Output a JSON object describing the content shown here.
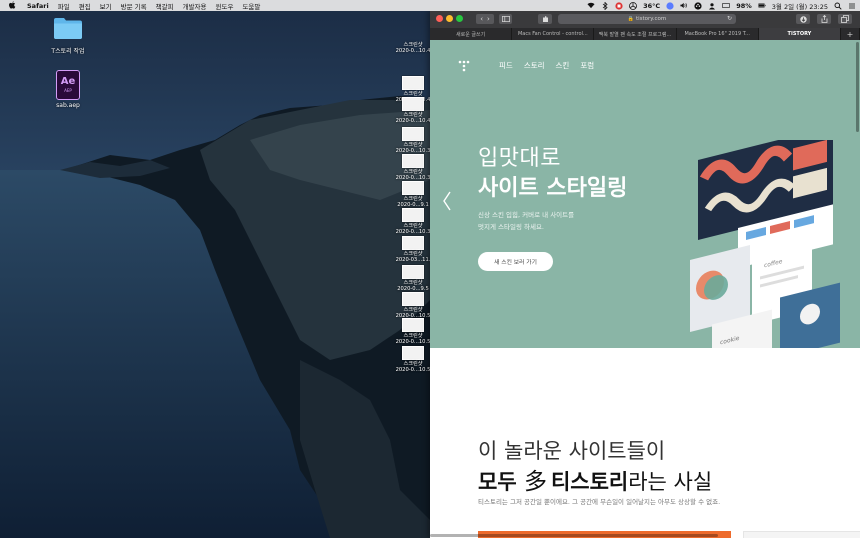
{
  "menubar": {
    "app_name": "Safari",
    "menus": [
      "파일",
      "편집",
      "보기",
      "방문 기록",
      "책갈피",
      "개발자용",
      "윈도우",
      "도움말"
    ],
    "temperature": "36°C",
    "battery": "98%",
    "clock": "3월 2일 (월)  23:25"
  },
  "desktop": {
    "folder_label": "T스토리 작업",
    "aep_badge": "Ae",
    "aep_sub": "AEP",
    "aep_label": "sab.aep",
    "screenshots": [
      {
        "line1": "스크린샷",
        "line2": "2020-0...10.4"
      },
      {
        "line1": "스크린샷",
        "line2": "2020-0...10.4"
      },
      {
        "line1": "스크린샷",
        "line2": "2020-0...10.4"
      },
      {
        "line1": "스크린샷",
        "line2": "2020-0...10.3"
      },
      {
        "line1": "스크린샷",
        "line2": "2020-0...10.3"
      },
      {
        "line1": "스크린샷",
        "line2": "2020-0...9.1"
      },
      {
        "line1": "스크린샷",
        "line2": "2020-0...10.3"
      },
      {
        "line1": "스크린샷",
        "line2": "2020-03...11."
      },
      {
        "line1": "스크린샷",
        "line2": "2020-0...9.5"
      },
      {
        "line1": "스크린샷",
        "line2": "2020-0...10.5"
      },
      {
        "line1": "스크린샷",
        "line2": "2020-0...10.5"
      },
      {
        "line1": "스크린샷",
        "line2": "2020-0...10.5"
      }
    ]
  },
  "safari": {
    "url": "tistory.com",
    "tabs": [
      {
        "label": "새로운 글쓰기",
        "active": false
      },
      {
        "label": "Macs Fan Control - control...",
        "active": false
      },
      {
        "label": "맥북 발열 팬 속도 조절 프로그램...",
        "active": false
      },
      {
        "label": "MacBook Pro 16\" 2019 T...",
        "active": false
      },
      {
        "label": "TISTORY",
        "active": true
      }
    ],
    "new_tab_symbol": "+"
  },
  "page": {
    "nav": [
      "피드",
      "스토리",
      "스킨",
      "포럼"
    ],
    "hero_line1": "입맛대로",
    "hero_line2": "사이트 스타일링",
    "hero_desc": [
      "신상 스킨 입힘, 커버로 내 사이트를",
      "멋지게 스타일링 하세요."
    ],
    "hero_cta": "새 스킨 보러 가기",
    "section_line1": "이 놀라운 사이트들이",
    "section_line2_a": "모두 ",
    "section_line2_hanja": "多",
    "section_line2_b": "티스토리",
    "section_line2_c": "라는 사실",
    "section_desc": "티스토리는 그저 공간일 뿐이에요. 그 공간에 무슨일이 일어날지는 아무도 상상할 수 없죠.",
    "mock_label_coffee": "coffee",
    "mock_label_cookie": "cookie"
  },
  "colors": {
    "hero_bg": "#8ab5a6",
    "accent_orange": "#ee6b2c",
    "tistory_red": "#e0563c"
  }
}
